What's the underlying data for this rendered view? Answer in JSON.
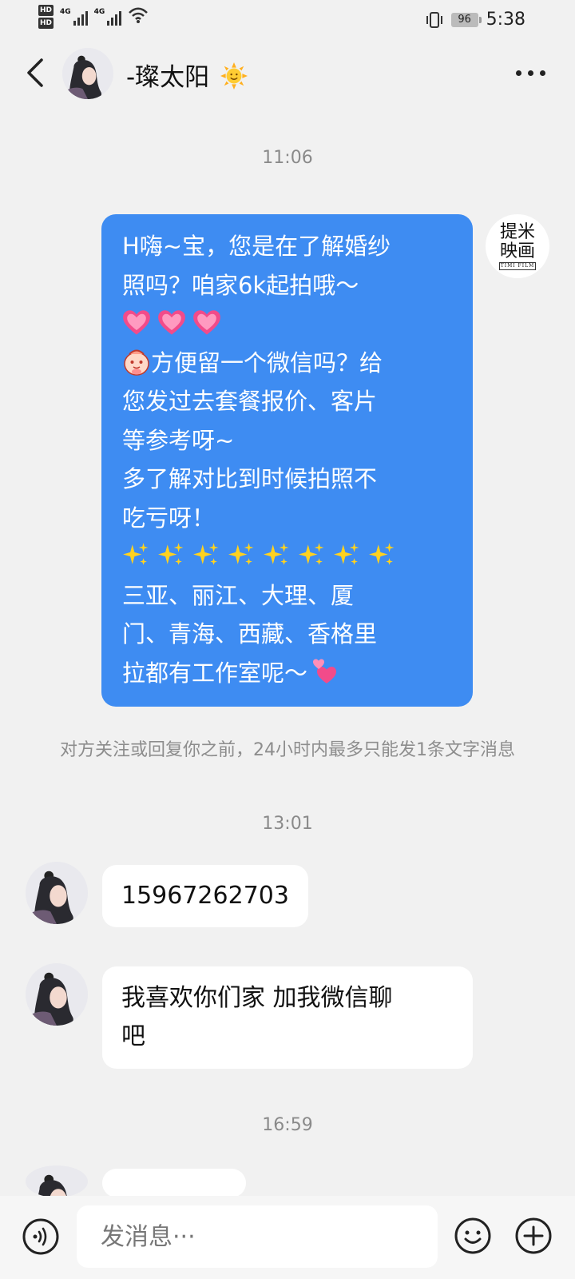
{
  "status_bar": {
    "hd_labels": [
      "HD",
      "HD"
    ],
    "network_labels": [
      "4G",
      "4G"
    ],
    "battery_level": "96",
    "time": "5:38"
  },
  "header": {
    "contact_name": "-璨太阳",
    "name_emoji": "sun-with-face-icon",
    "back_icon": "chevron-left-icon",
    "more_icon": "more-dots-icon"
  },
  "messages": {
    "time_1": "11:06",
    "outgoing_1": {
      "lines": [
        "H嗨~宝，您是在了解婚纱",
        "照吗？咱家6k起拍哦～",
        "",
        "方便留一个微信吗？给",
        "您发过去套餐报价、客片",
        "等参考呀~",
        "多了解对比到时候拍照不",
        "吃亏呀！",
        "",
        "三亚、丽江、大理、厦",
        "门、青海、西藏、香格里",
        "拉都有工作室呢～"
      ],
      "emoji": [
        "heart-icon",
        "heart-icon",
        "heart-icon",
        "bowing-face-icon",
        "sparkles-icon",
        "two-hearts-icon"
      ],
      "avatar_text": "提米映画"
    },
    "notice": "对方关注或回复你之前，24小时内最多只能发1条文字消息",
    "time_2": "13:01",
    "incoming_1": "15967262703",
    "incoming_2_line1": "我喜欢你们家 加我微信聊",
    "incoming_2_line2": "吧",
    "time_3": "16:59"
  },
  "input_bar": {
    "placeholder": "发消息···"
  },
  "colors": {
    "outgoing_bubble": "#3e8cf2",
    "background": "#f1f1f1",
    "incoming_bubble": "#ffffff"
  }
}
